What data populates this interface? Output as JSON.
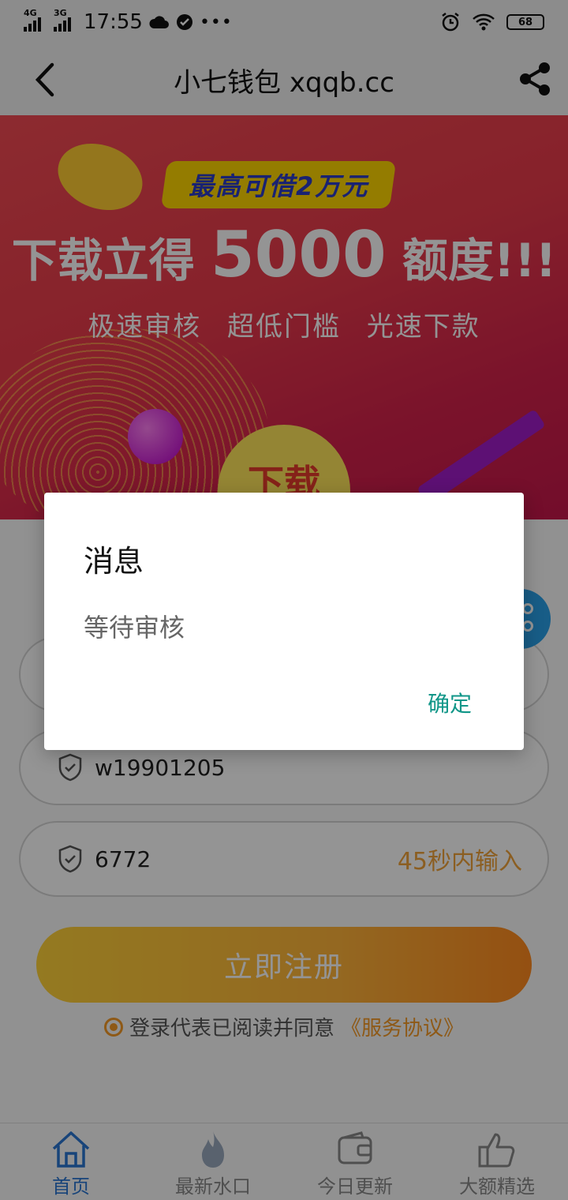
{
  "status_bar": {
    "net1": "4G",
    "net2": "3G",
    "time": "17:55",
    "battery": "68",
    "icons": [
      "signal-icon",
      "cloud-icon",
      "check-circle-icon",
      "more-icon",
      "alarm-icon",
      "wifi-icon",
      "battery-icon"
    ]
  },
  "titlebar": {
    "title": "小七钱包 xqqb.cc",
    "back_icon": "chevron-left-icon",
    "share_icon": "share-icon"
  },
  "banner": {
    "tag": "最高可借2万元",
    "headline_pre": "下载立得",
    "headline_amount": "5000",
    "headline_post": "额度!!!",
    "features": "极速审核   超低门槛   光速下款",
    "download_label": "下载"
  },
  "form": {
    "fields": [
      {
        "value": "w19901205",
        "icon": "shield-icon"
      },
      {
        "value": "6772",
        "hint": "45秒内输入",
        "icon": "shield-icon"
      }
    ],
    "register_label": "立即注册",
    "agree_text": "登录代表已阅读并同意",
    "agree_link": "《服务协议》"
  },
  "tabbar": {
    "items": [
      {
        "label": "首页",
        "icon": "home-icon",
        "active": true
      },
      {
        "label": "最新水口",
        "icon": "flame-icon",
        "active": false
      },
      {
        "label": "今日更新",
        "icon": "wallet-icon",
        "active": false
      },
      {
        "label": "大额精选",
        "icon": "thumbs-up-icon",
        "active": false
      }
    ]
  },
  "dialog": {
    "title": "消息",
    "message": "等待审核",
    "ok_label": "确定"
  },
  "colors": {
    "accent": "#109688",
    "orange": "#f59a26",
    "blue": "#2a76d2"
  }
}
